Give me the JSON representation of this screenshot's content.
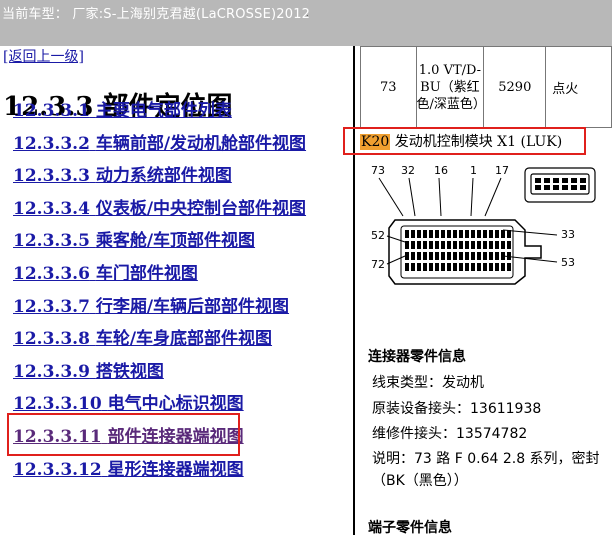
{
  "topbar": {
    "text": "当前车型：  厂家:S-上海别克君越(LaCROSSE)2012",
    "dot": "."
  },
  "left": {
    "back_link": "[返回上一级]",
    "title_num": "12.3.3",
    "title_text": "部件定位图",
    "nav": [
      {
        "num": "12.3.3.1",
        "label": "主要电气部件列表"
      },
      {
        "num": "12.3.3.2",
        "label": "车辆前部/发动机舱部件视图"
      },
      {
        "num": "12.3.3.3",
        "label": "动力系统部件视图"
      },
      {
        "num": "12.3.3.4",
        "label": "仪表板/中央控制台部件视图"
      },
      {
        "num": "12.3.3.5",
        "label": "乘客舱/车顶部件视图"
      },
      {
        "num": "12.3.3.6",
        "label": "车门部件视图"
      },
      {
        "num": "12.3.3.7",
        "label": "行李厢/车辆后部部件视图"
      },
      {
        "num": "12.3.3.8",
        "label": "车轮/车身底部部件视图"
      },
      {
        "num": "12.3.3.9",
        "label": "搭铁视图"
      },
      {
        "num": "12.3.3.10",
        "label": "电气中心标识视图"
      },
      {
        "num": "12.3.3.11",
        "label": "部件连接器端视图"
      },
      {
        "num": "12.3.3.12",
        "label": "星形连接器端视图"
      }
    ]
  },
  "right": {
    "table_row": {
      "pin": "73",
      "wire_line1": "1.0 VT/D-",
      "wire_line2": "BU（紫红",
      "wire_line3": "色/深蓝色）",
      "circuit": "5290",
      "func": "点火"
    },
    "k20_tag": "K20",
    "k20_text": " 发动机控制模块 X1 (LUK)",
    "connector_labels": {
      "p73": "73",
      "p32": "32",
      "p16": "16",
      "p1": "1",
      "p17": "17",
      "p52": "52",
      "p72": "72",
      "p33": "33",
      "p53": "53"
    },
    "info_heading": "连接器零件信息",
    "info": {
      "harness": "线束类型：发动机",
      "oem": "原装设备接头：13611938",
      "service": "维修件接头：13574782",
      "desc": "说明：73 路 F 0.64 2.8 系列，密封",
      "color": "（BK（黑色））"
    },
    "terminal_heading": "端子零件信息"
  }
}
